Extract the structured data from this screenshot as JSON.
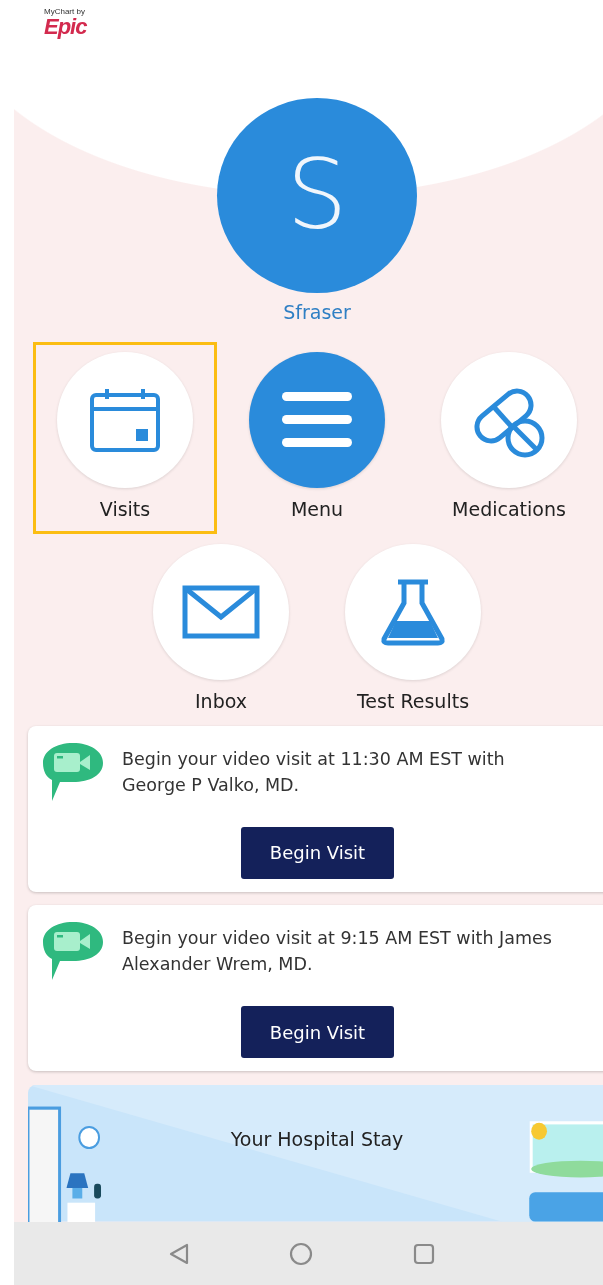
{
  "logo": {
    "tagline": "MyChart by",
    "brand": "Epic"
  },
  "profile": {
    "initial": "S",
    "name": "Sfraser"
  },
  "shortcut_rows": [
    {
      "items": [
        {
          "label": "Visits",
          "kind": "calendar",
          "selected": true
        },
        {
          "label": "Menu",
          "kind": "menu",
          "selected": false
        },
        {
          "label": "Medications",
          "kind": "pills",
          "selected": false
        }
      ]
    },
    {
      "items": [
        {
          "label": "Inbox",
          "kind": "mail",
          "selected": false
        },
        {
          "label": "Test Results",
          "kind": "flask",
          "selected": false
        }
      ]
    }
  ],
  "cards": [
    {
      "message": "Begin your video visit at 11:30 AM EST with George P Valko, MD.",
      "button": "Begin Visit"
    },
    {
      "message": "Begin your video visit at 9:15 AM EST with James Alexander Wrem, MD.",
      "button": "Begin Visit"
    }
  ],
  "banner": {
    "title": "Your Hospital Stay",
    "kind": "picture"
  }
}
